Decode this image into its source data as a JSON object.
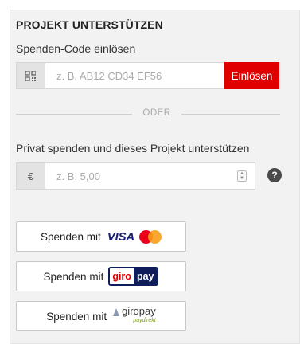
{
  "panel": {
    "title": "PROJEKT UNTERSTÜTZEN",
    "code_section": {
      "label": "Spenden-Code einlösen",
      "input_placeholder": "z. B. AB12 CD34 EF56",
      "input_value": "",
      "redeem_button": "Einlösen",
      "icon": "qr-code-icon"
    },
    "divider_text": "ODER",
    "private_section": {
      "label": "Privat spenden und dieses Projekt unterstützen",
      "currency": "€",
      "amount_placeholder": "z. B. 5,00",
      "amount_value": "",
      "help_icon": "question-circle-icon",
      "help_glyph": "?"
    },
    "payment_buttons": [
      {
        "prefix": "Spenden mit",
        "method_text": "VISA",
        "icon": "mastercard-icon"
      },
      {
        "prefix": "Spenden mit",
        "method_text_1": "giro",
        "method_text_2": "pay"
      },
      {
        "prefix": "Spenden mit",
        "method_text": "giropay",
        "method_sub": "paydirekt",
        "icon": "paydirekt-icon"
      }
    ]
  },
  "colors": {
    "accent": "#e10000",
    "panel_bg": "#f2f2f2",
    "visa_blue": "#1a1f71",
    "giropay_navy": "#0f1e5a"
  }
}
